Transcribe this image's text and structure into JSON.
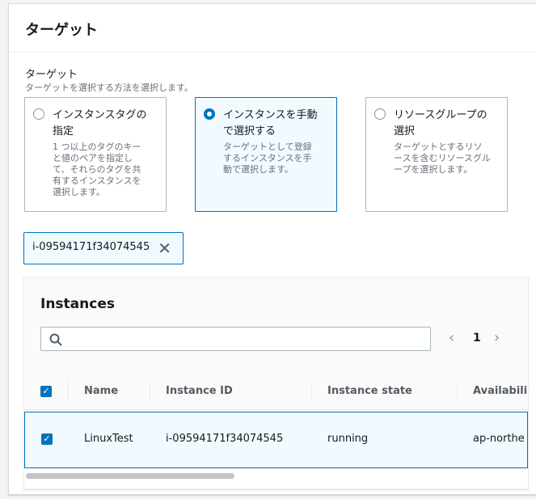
{
  "panel": {
    "title": "ターゲット"
  },
  "target_field": {
    "label": "ターゲット",
    "description": "ターゲットを選択する方法を選択します。"
  },
  "tiles": [
    {
      "title_line1": "インスタンスタグの",
      "title_line2": "指定",
      "desc_lines": [
        "1 つ以上のタグのキー",
        "と値のペアを指定し",
        "て、それらのタグを共",
        "有するインスタンスを",
        "選択します。"
      ],
      "selected": false
    },
    {
      "title_line1": "インスタンスを手動",
      "title_line2": "で選択する",
      "desc_lines": [
        "ターゲットとして登録",
        "するインスタンスを手",
        "動で選択します。"
      ],
      "selected": true
    },
    {
      "title_line1": "リソースグループの",
      "title_line2": "選択",
      "desc_lines": [
        "ターゲットとするリソ",
        "ースを含むリソースグル",
        "ープを選択します。"
      ],
      "selected": false
    }
  ],
  "token": {
    "label": "i-09594171f34074545",
    "close_icon": "close-icon"
  },
  "instances_table": {
    "title": "Instances",
    "search": {
      "value": "",
      "placeholder": ""
    },
    "pagination": {
      "prev_icon": "chevron-left-icon",
      "current_page": "1",
      "next_icon": "chevron-right-icon"
    },
    "columns": [
      "Name",
      "Instance ID",
      "Instance state",
      "Availabili"
    ],
    "rows": [
      {
        "name": "LinuxTest",
        "instance_id": "i-09594171f34074545",
        "state": "running",
        "az": "ap-northe",
        "checked": true
      }
    ]
  },
  "colors": {
    "accent": "#0073bb",
    "selected_bg": "#f1faff",
    "border": "#aab7b8",
    "muted_text": "#687078"
  }
}
